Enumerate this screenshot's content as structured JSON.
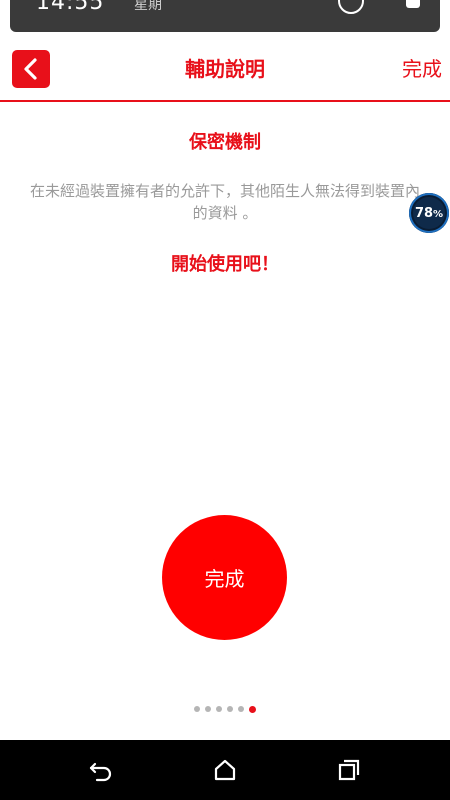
{
  "status_bar": {
    "time": "14:55",
    "date": "星期"
  },
  "header": {
    "title": "輔助說明",
    "done_label": "完成"
  },
  "content": {
    "section_title": "保密機制",
    "description": "在未經過裝置擁有者的允許下，其他陌生人無法得到裝置內的資料 。",
    "cta": "開始使用吧！"
  },
  "battery_widget": {
    "percent": "78",
    "unit": "%"
  },
  "done_button_label": "完成",
  "pager": {
    "total": 6,
    "active_index": 5
  },
  "colors": {
    "accent": "#e8101a",
    "button_red": "#ff0000",
    "nav_bar": "#000000"
  },
  "icons": [
    "back-arrow-icon",
    "nav-back-icon",
    "nav-home-icon",
    "nav-recents-icon"
  ]
}
